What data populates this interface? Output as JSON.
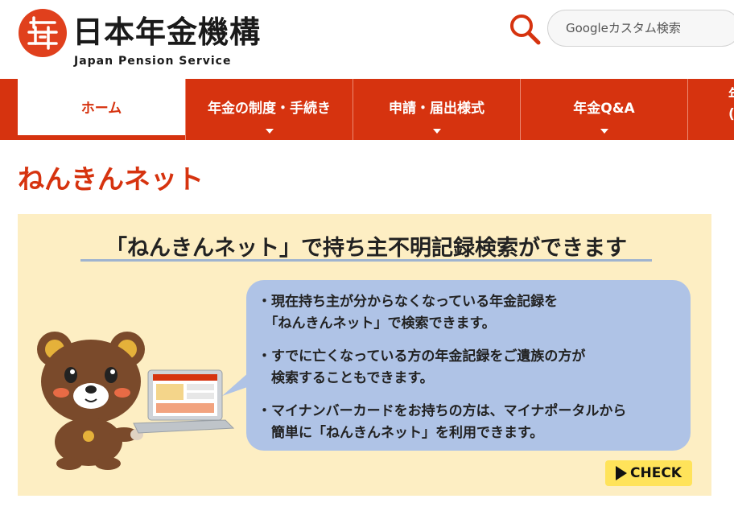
{
  "header": {
    "logo_title": "日本年金機構",
    "logo_subtitle": "Japan Pension Service",
    "search_placeholder": "Googleカスタム検索"
  },
  "nav": {
    "items": [
      {
        "label": "ホーム",
        "active": true
      },
      {
        "label": "年金の制度・手続き"
      },
      {
        "label": "申請・届出様式"
      },
      {
        "label": "年金Q&A"
      },
      {
        "label": "年\n("
      }
    ]
  },
  "page": {
    "title": "ねんきんネット"
  },
  "banner": {
    "heading": "「ねんきんネット」で持ち主不明記録検索ができます",
    "bullets": [
      "・現在持ち主が分からなくなっている年金記録を\n　「ねんきんネット」で検索できます。",
      "・すでに亡くなっている方の年金記録をご遺族の方が\n　検索することもできます。",
      "・マイナンバーカードをお持ちの方は、マイナポータルから\n　簡単に「ねんきんネット」を利用できます。"
    ],
    "check_label": "CHECK"
  },
  "colors": {
    "brand_red": "#d6330f",
    "banner_bg": "#fdeec3",
    "bubble_bg": "#afc3e6",
    "check_bg": "#ffe35a"
  }
}
